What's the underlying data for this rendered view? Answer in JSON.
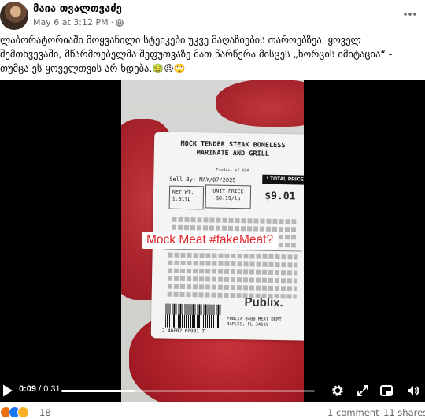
{
  "post": {
    "author": "მაია თვალთვაძე",
    "timestamp": "May 6 at 3:12 PM",
    "separator": "·",
    "caption_lines": [
      "ლაბორატორიაში მოყვანილი სტეიკები უკვე მაღაზიების თაროებზეა. ყოველ",
      "შემთხვევაში, მწარმოებელმა შეფუთვაზე მათ წარწერა მისცეს  „ხორცის იმიტაცია“ -",
      "თუმცა ეს ყოველთვის არ ხდება."
    ],
    "caption_emojis": "🤢😠🙄"
  },
  "video": {
    "overlay_text": "Mock Meat #fakeMeat?",
    "current_time": "0:09",
    "time_separator": " / ",
    "duration": "0:31",
    "progress_percent": 29,
    "label": {
      "title": "MOCK TENDER STEAK BONELESS\nMARINATE AND GRILL",
      "origin": "Product of USA",
      "sell_by": "Sell By:  MAY/07/2025",
      "total_price_label": "* TOTAL PRICE",
      "net_wt_label": "NET WT.",
      "net_wt_value": "1.01lb",
      "unit_price_label": "UNIT PRICE",
      "unit_price_value": "$8.19/lb",
      "total_price": "$9.01",
      "brand": "Publix.",
      "barcode_number": "2 46002 60901 7",
      "dept_text": "PUBLIX 0480 MEAT DEPT\nNAPLES, FL  34109"
    }
  },
  "footer": {
    "reaction_count": "18",
    "comments": "1 comment",
    "shares": "11 shares"
  },
  "colors": {
    "overlay_red": "#e0262c",
    "meta_gray": "#65676b",
    "reaction_angry": "#e9710f",
    "reaction_like": "#1877f2",
    "reaction_sad": "#f7b125"
  },
  "icons": [
    "globe-icon",
    "more-options-icon",
    "play-icon",
    "settings-icon",
    "fullscreen-icon",
    "miniplayer-icon",
    "volume-icon"
  ]
}
